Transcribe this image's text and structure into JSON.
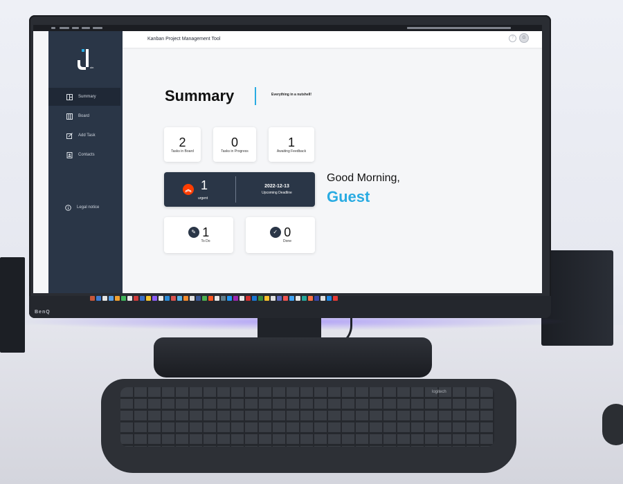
{
  "app": {
    "header_title": "Kanban Project Management Tool",
    "logo_letter": "J",
    "logo_sub": "oin",
    "help": "?",
    "avatar": "G"
  },
  "sidebar": {
    "items": [
      {
        "label": "Summary",
        "icon": "summary-icon",
        "active": true
      },
      {
        "label": "Board",
        "icon": "board-icon"
      },
      {
        "label": "Add Task",
        "icon": "add-task-icon"
      },
      {
        "label": "Contacts",
        "icon": "contacts-icon"
      }
    ],
    "legal": "Legal notice"
  },
  "summary": {
    "title": "Summary",
    "subtitle": "Everything in a nutshell!"
  },
  "stats": {
    "tasks_in_board": {
      "value": "2",
      "label": "Tasks in Board"
    },
    "tasks_in_progress": {
      "value": "0",
      "label": "Tasks in Progress"
    },
    "awaiting_feedback": {
      "value": "1",
      "label": "Awaiting Feedback"
    },
    "urgent": {
      "value": "1",
      "label": "urgent"
    },
    "deadline": {
      "date": "2022-12-13",
      "label": "Upcoming Deadline"
    },
    "todo": {
      "value": "1",
      "label": "To Do"
    },
    "done": {
      "value": "0",
      "label": "Done"
    }
  },
  "greeting": {
    "text": "Good Morning,",
    "name": "Guest"
  },
  "monitor": {
    "brand": "BenQ"
  },
  "keyboard": {
    "brand": "logitech"
  },
  "colors": {
    "accent": "#29abe2",
    "sidebar": "#2a3647",
    "urgent": "#ff3d00"
  }
}
